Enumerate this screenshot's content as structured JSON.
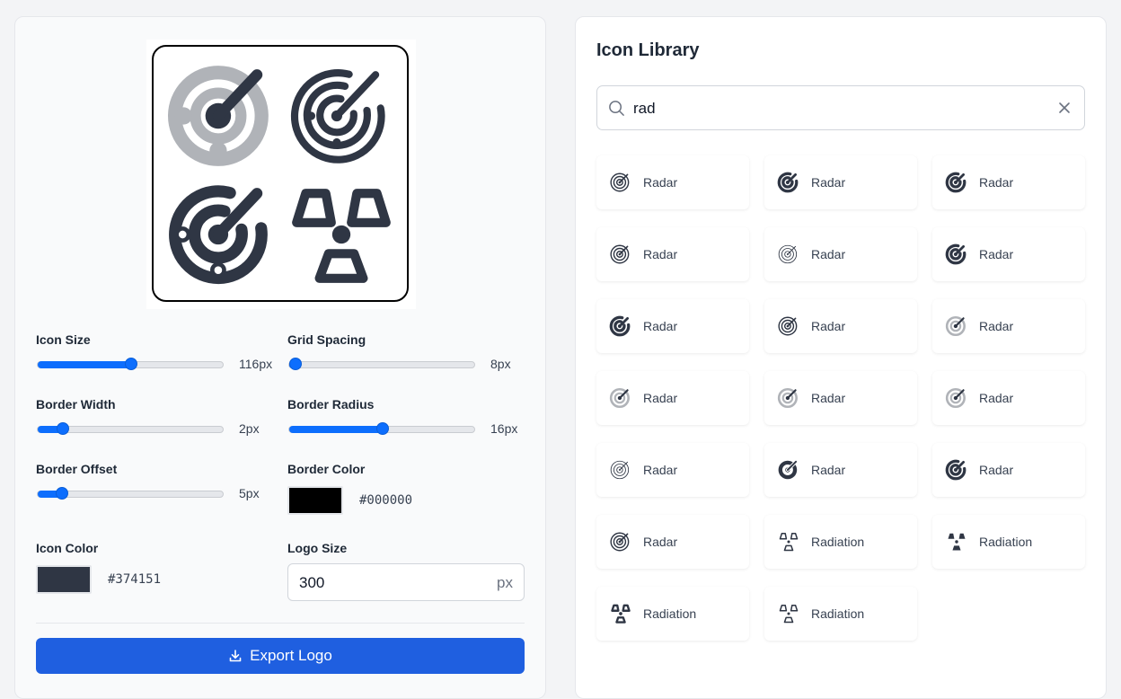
{
  "controls": {
    "icon_size": {
      "label": "Icon Size",
      "value": "116px",
      "level": 0.5
    },
    "grid_spacing": {
      "label": "Grid Spacing",
      "value": "8px",
      "level": 0.0
    },
    "border_width": {
      "label": "Border Width",
      "value": "2px",
      "level": 0.1
    },
    "border_radius": {
      "label": "Border Radius",
      "value": "16px",
      "level": 0.5
    },
    "border_offset": {
      "label": "Border Offset",
      "value": "5px",
      "level": 0.1
    },
    "border_color": {
      "label": "Border Color",
      "hex": "#000000"
    },
    "icon_color": {
      "label": "Icon Color",
      "hex": "#374151"
    },
    "logo_size": {
      "label": "Logo Size",
      "value": "300",
      "unit": "px"
    }
  },
  "export_label": "Export Logo",
  "library": {
    "title": "Icon Library",
    "search_value": "rad",
    "items": [
      {
        "label": "Radar",
        "icon": "radar-outline-icon"
      },
      {
        "label": "Radar",
        "icon": "radar-bold-icon"
      },
      {
        "label": "Radar",
        "icon": "radar-bold-icon"
      },
      {
        "label": "Radar",
        "icon": "radar-outline-icon"
      },
      {
        "label": "Radar",
        "icon": "radar-thin-icon"
      },
      {
        "label": "Radar",
        "icon": "radar-bold-icon"
      },
      {
        "label": "Radar",
        "icon": "radar-bold-icon"
      },
      {
        "label": "Radar",
        "icon": "radar-outline-icon"
      },
      {
        "label": "Radar",
        "icon": "radar-duotone-icon"
      },
      {
        "label": "Radar",
        "icon": "radar-duotone-icon"
      },
      {
        "label": "Radar",
        "icon": "radar-duotone-icon"
      },
      {
        "label": "Radar",
        "icon": "radar-duotone-icon"
      },
      {
        "label": "Radar",
        "icon": "radar-thin-icon"
      },
      {
        "label": "Radar",
        "icon": "radar-fill-icon"
      },
      {
        "label": "Radar",
        "icon": "radar-bold-icon"
      },
      {
        "label": "Radar",
        "icon": "radar-outline-icon"
      },
      {
        "label": "Radiation",
        "icon": "radiation-outline-icon"
      },
      {
        "label": "Radiation",
        "icon": "radiation-fill-icon"
      },
      {
        "label": "Radiation",
        "icon": "radiation-bold-icon"
      },
      {
        "label": "Radiation",
        "icon": "radiation-outline-icon"
      }
    ]
  },
  "colors": {
    "accent": "#1f5fe0",
    "slider": "#0d6efd",
    "icon": "#374151"
  }
}
